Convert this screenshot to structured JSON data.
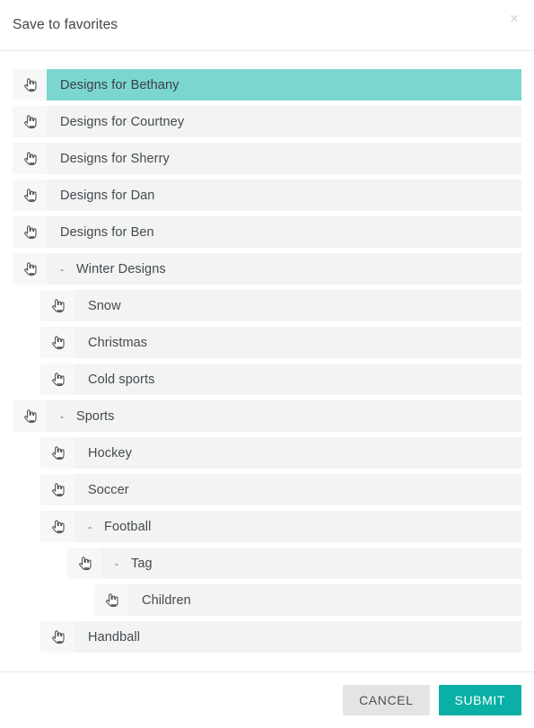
{
  "dialog": {
    "title": "Save to favorites",
    "close_label": "×",
    "close_icon": "close-icon"
  },
  "tree": {
    "item_icon": "hand-pointer-icon",
    "collapse_marker": "-",
    "items": [
      {
        "label": "Designs for Bethany",
        "level": 0,
        "selected": true,
        "toggle": ""
      },
      {
        "label": "Designs for Courtney",
        "level": 0,
        "selected": false,
        "toggle": ""
      },
      {
        "label": "Designs for Sherry",
        "level": 0,
        "selected": false,
        "toggle": ""
      },
      {
        "label": "Designs for Dan",
        "level": 0,
        "selected": false,
        "toggle": ""
      },
      {
        "label": "Designs for Ben",
        "level": 0,
        "selected": false,
        "toggle": ""
      },
      {
        "label": "Winter Designs",
        "level": 0,
        "selected": false,
        "toggle": "-"
      },
      {
        "label": "Snow",
        "level": 1,
        "selected": false,
        "toggle": ""
      },
      {
        "label": "Christmas",
        "level": 1,
        "selected": false,
        "toggle": ""
      },
      {
        "label": "Cold sports",
        "level": 1,
        "selected": false,
        "toggle": ""
      },
      {
        "label": "Sports",
        "level": 0,
        "selected": false,
        "toggle": "-"
      },
      {
        "label": "Hockey",
        "level": 1,
        "selected": false,
        "toggle": ""
      },
      {
        "label": "Soccer",
        "level": 1,
        "selected": false,
        "toggle": ""
      },
      {
        "label": "Football",
        "level": 1,
        "selected": false,
        "toggle": "-"
      },
      {
        "label": "Tag",
        "level": 2,
        "selected": false,
        "toggle": "-"
      },
      {
        "label": "Children",
        "level": 3,
        "selected": false,
        "toggle": ""
      },
      {
        "label": "Handball",
        "level": 1,
        "selected": false,
        "toggle": ""
      }
    ]
  },
  "footer": {
    "cancel_label": "CANCEL",
    "submit_label": "SUBMIT"
  },
  "colors": {
    "selected_row": "#7bd6d0",
    "row_background": "#f2f3f3",
    "icon_cell_background": "#f7f7f7",
    "submit_button": "#0aafa5",
    "cancel_button": "#e4e4e4",
    "text": "#45494e"
  }
}
